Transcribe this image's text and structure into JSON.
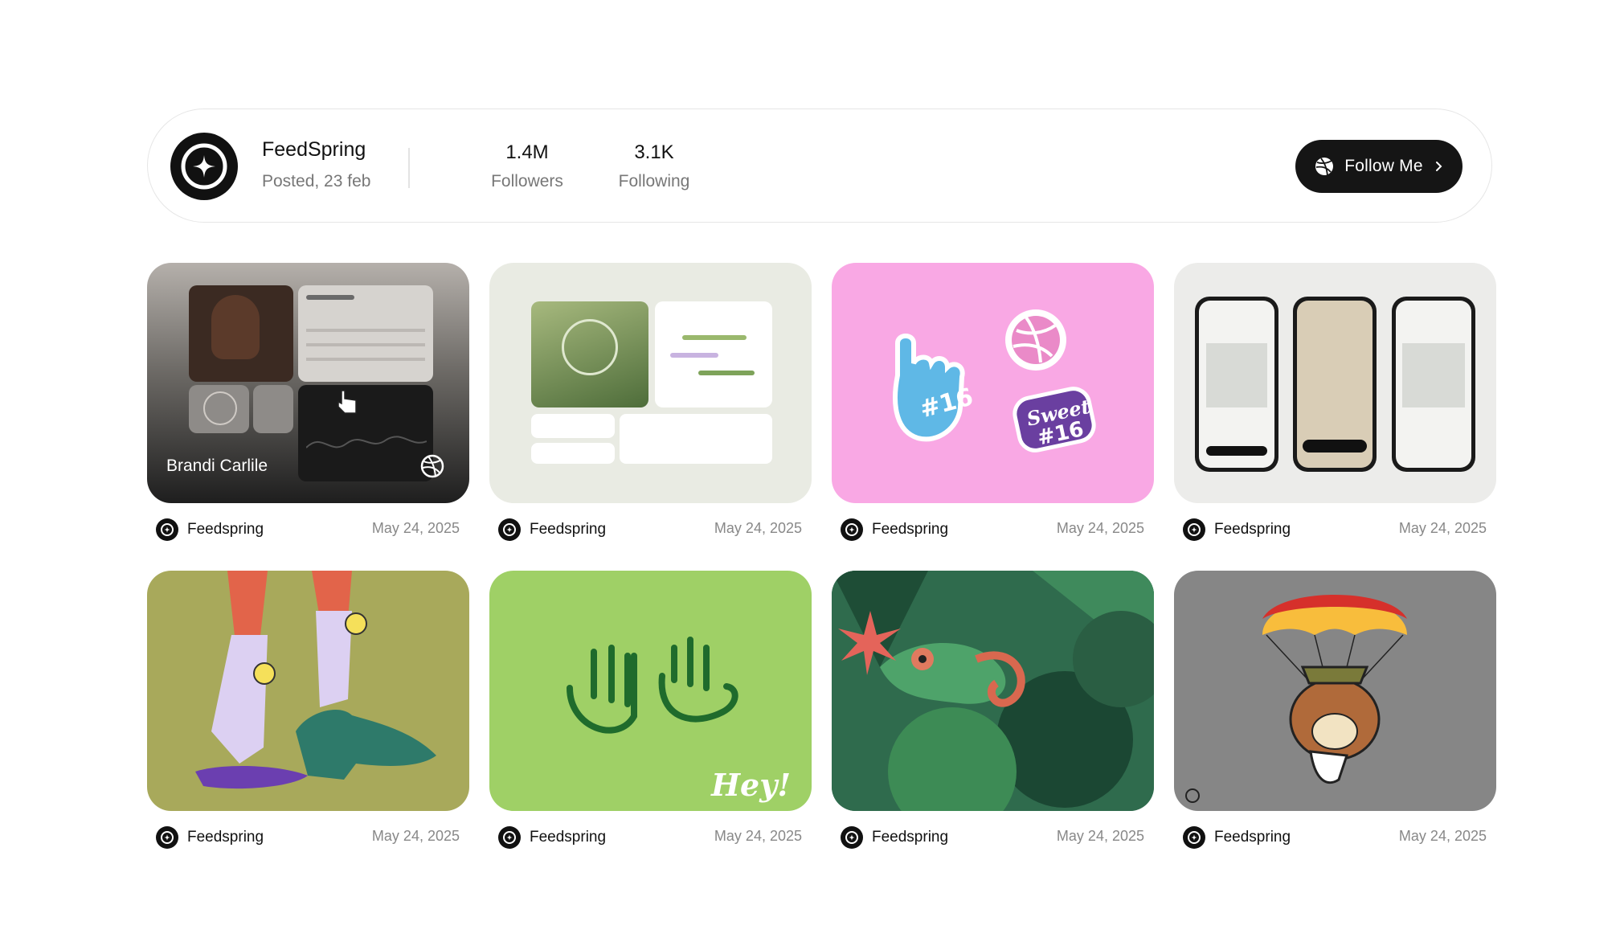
{
  "profile": {
    "name": "FeedSpring",
    "posted": "Posted, 23 feb",
    "followers_value": "1.4M",
    "followers_label": "Followers",
    "following_value": "3.1K",
    "following_label": "Following",
    "follow_button_label": "Follow Me",
    "follow_button_icon": "dribbble-icon"
  },
  "shots": [
    {
      "author": "Feedspring",
      "date": "May 24, 2025",
      "overlay_title": "Brandi Carlile"
    },
    {
      "author": "Feedspring",
      "date": "May 24, 2025"
    },
    {
      "author": "Feedspring",
      "date": "May 24, 2025"
    },
    {
      "author": "Feedspring",
      "date": "May 24, 2025"
    },
    {
      "author": "Feedspring",
      "date": "May 24, 2025"
    },
    {
      "author": "Feedspring",
      "date": "May 24, 2025",
      "art_text": "Hey!"
    },
    {
      "author": "Feedspring",
      "date": "May 24, 2025"
    },
    {
      "author": "Feedspring",
      "date": "May 24, 2025"
    }
  ],
  "colors": {
    "button_bg": "#151515",
    "muted_text": "#777777",
    "card_border": "#e6e6e6"
  }
}
